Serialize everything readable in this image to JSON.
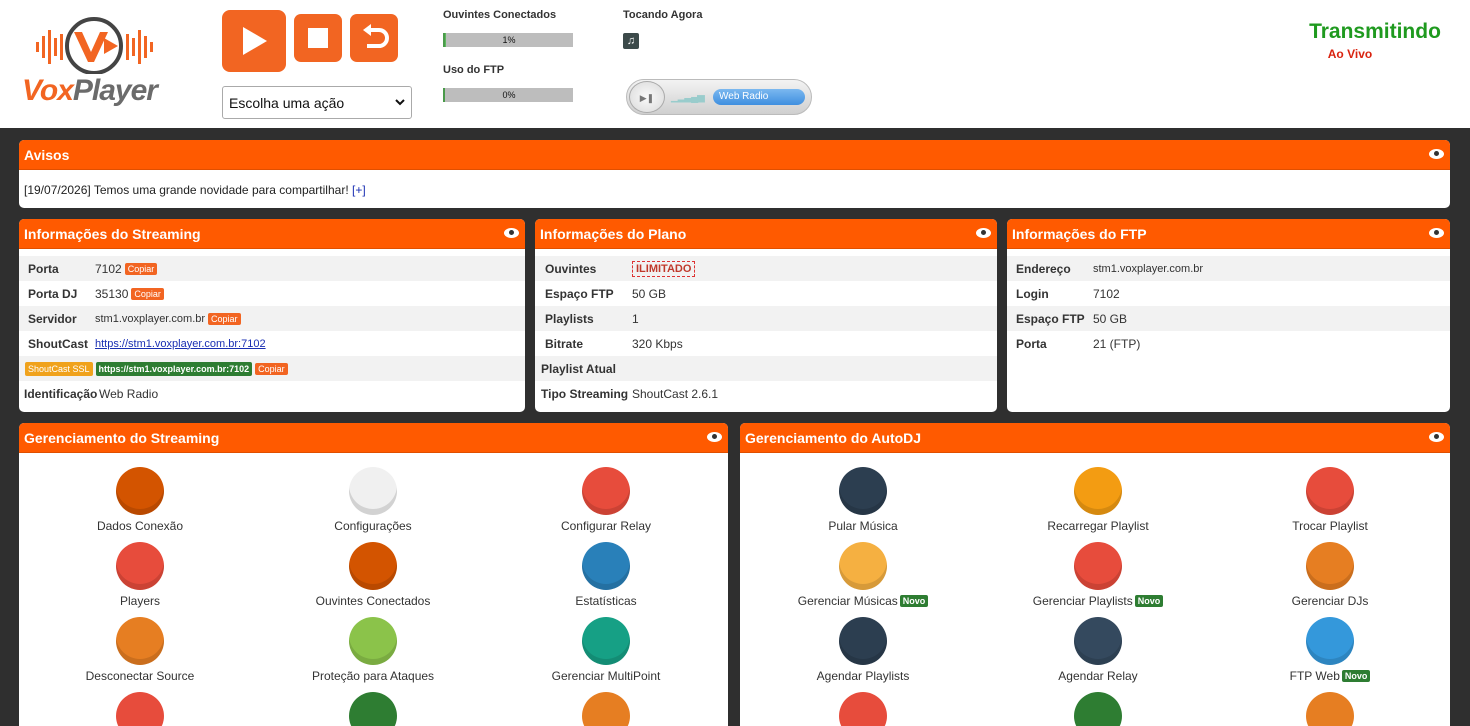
{
  "header": {
    "logo": {
      "part1": "Vox",
      "part2": "Player"
    },
    "buttons": {
      "play_icon": "play-icon",
      "stop_icon": "stop-icon",
      "restart_icon": "restart-icon"
    },
    "action_select": {
      "value": "Escolha uma ação"
    },
    "listeners": {
      "label": "Ouvintes Conectados",
      "percent_text": "1%",
      "fill": 0.01
    },
    "ftp_usage": {
      "label": "Uso do FTP",
      "percent_text": "0%",
      "fill": 0.0
    },
    "now_playing": {
      "label": "Tocando Agora"
    },
    "mini_player": {
      "label": "Web Radio"
    },
    "status": {
      "title": "Transmitindo",
      "subtitle": "Ao Vivo"
    }
  },
  "notices": {
    "title": "Avisos",
    "text": "[19/07/2026] Temos uma grande novidade para compartilhar!",
    "link": "[+]"
  },
  "streaming_info": {
    "title": "Informações do Streaming",
    "copy_label": "Copiar",
    "porta": {
      "key": "Porta",
      "value": "7102"
    },
    "porta_dj": {
      "key": "Porta DJ",
      "value": "35130"
    },
    "servidor": {
      "key": "Servidor",
      "value": "stm1.voxplayer.com.br"
    },
    "shoutcast": {
      "key": "ShoutCast",
      "value": "https://stm1.voxplayer.com.br:7102"
    },
    "ssl": {
      "badge": "ShoutCast SSL",
      "value": "https://stm1.voxplayer.com.br:7102"
    },
    "identificacao": {
      "key": "Identificação",
      "value": "Web Radio"
    }
  },
  "plan_info": {
    "title": "Informações do Plano",
    "ouvintes": {
      "key": "Ouvintes",
      "value": "ILIMITADO"
    },
    "espaco": {
      "key": "Espaço FTP",
      "value": "50 GB"
    },
    "playlists": {
      "key": "Playlists",
      "value": "1"
    },
    "bitrate": {
      "key": "Bitrate",
      "value": "320 Kbps"
    },
    "playlist_atual": {
      "key": "Playlist Atual",
      "value": ""
    },
    "tipo": {
      "key": "Tipo Streaming",
      "value": "ShoutCast 2.6.1"
    }
  },
  "ftp_info": {
    "title": "Informações do FTP",
    "endereco": {
      "key": "Endereço",
      "value": "stm1.voxplayer.com.br"
    },
    "login": {
      "key": "Login",
      "value": "7102"
    },
    "espaco": {
      "key": "Espaço FTP",
      "value": "50 GB"
    },
    "porta": {
      "key": "Porta",
      "value": "21 (FTP)"
    }
  },
  "streaming_mgmt": {
    "title": "Gerenciamento do Streaming",
    "items": [
      {
        "label": "Dados Conexão",
        "icon": "antenna-icon",
        "color": "#d35400"
      },
      {
        "label": "Configurações",
        "icon": "settings-doc-icon",
        "color": "#f0f0f0"
      },
      {
        "label": "Configurar Relay",
        "icon": "play-circle-icon",
        "color": "#e74c3c"
      },
      {
        "label": "Players",
        "icon": "player-icon",
        "color": "#e74c3c"
      },
      {
        "label": "Ouvintes Conectados",
        "icon": "users-icon",
        "color": "#d35400"
      },
      {
        "label": "Estatísticas",
        "icon": "stats-icon",
        "color": "#2980b9"
      },
      {
        "label": "Desconectar Source",
        "icon": "exit-door-icon",
        "color": "#e67e22"
      },
      {
        "label": "Proteção para Ataques",
        "icon": "shield-bug-icon",
        "color": "#8bc34a"
      },
      {
        "label": "Gerenciar MultiPoint",
        "icon": "network-icon",
        "color": "#16a085"
      }
    ]
  },
  "autodj_mgmt": {
    "title": "Gerenciamento do AutoDJ",
    "new_label": "Novo",
    "items": [
      {
        "label": "Pular Música",
        "icon": "skip-music-icon",
        "color": "#2c3e50",
        "novo": false
      },
      {
        "label": "Recarregar Playlist",
        "icon": "reload-playlist-icon",
        "color": "#f39c12",
        "novo": false
      },
      {
        "label": "Trocar Playlist",
        "icon": "swap-playlist-icon",
        "color": "#e74c3c",
        "novo": false
      },
      {
        "label": "Gerenciar Músicas",
        "icon": "music-files-icon",
        "color": "#f5b041",
        "novo": true
      },
      {
        "label": "Gerenciar Playlists",
        "icon": "manage-playlists-icon",
        "color": "#e74c3c",
        "novo": true
      },
      {
        "label": "Gerenciar DJs",
        "icon": "dj-icon",
        "color": "#e67e22",
        "novo": false
      },
      {
        "label": "Agendar Playlists",
        "icon": "calendar-icon",
        "color": "#2c3e50",
        "novo": false
      },
      {
        "label": "Agendar Relay",
        "icon": "calendar-clock-icon",
        "color": "#34495e",
        "novo": false
      },
      {
        "label": "FTP Web",
        "icon": "ftp-web-icon",
        "color": "#3498db",
        "novo": true
      }
    ]
  }
}
